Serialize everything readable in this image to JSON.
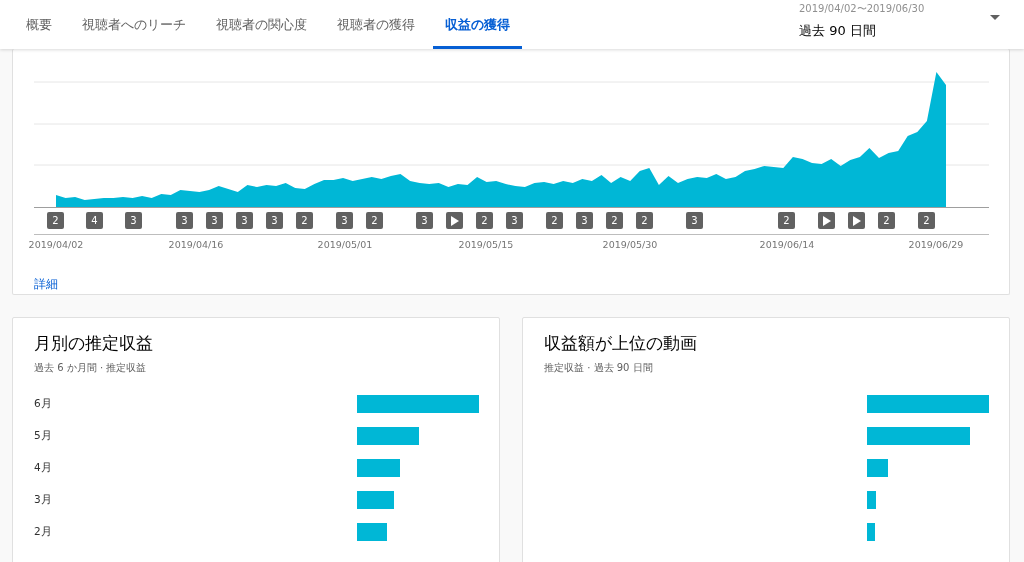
{
  "tabs": [
    {
      "label": "概要",
      "selected": false
    },
    {
      "label": "視聴者へのリーチ",
      "selected": false
    },
    {
      "label": "視聴者の関心度",
      "selected": false
    },
    {
      "label": "視聴者の獲得",
      "selected": false
    },
    {
      "label": "収益の獲得",
      "selected": true
    }
  ],
  "date_range": {
    "range": "2019/04/02〜2019/06/30",
    "period": "過去 90 日間"
  },
  "revenue_chart": {
    "markers": [
      {
        "kind": "count",
        "label": "2"
      },
      {
        "kind": "count",
        "label": "4"
      },
      {
        "kind": "count",
        "label": "3"
      },
      {
        "kind": "count",
        "label": "3"
      },
      {
        "kind": "count",
        "label": "3"
      },
      {
        "kind": "count",
        "label": "3"
      },
      {
        "kind": "count",
        "label": "3"
      },
      {
        "kind": "count",
        "label": "2"
      },
      {
        "kind": "count",
        "label": "3"
      },
      {
        "kind": "count",
        "label": "2"
      },
      {
        "kind": "count",
        "label": "3"
      },
      {
        "kind": "play"
      },
      {
        "kind": "count",
        "label": "2"
      },
      {
        "kind": "count",
        "label": "3"
      },
      {
        "kind": "count",
        "label": "2"
      },
      {
        "kind": "count",
        "label": "3"
      },
      {
        "kind": "count",
        "label": "2"
      },
      {
        "kind": "count",
        "label": "2"
      },
      {
        "kind": "count",
        "label": "3"
      },
      {
        "kind": "count",
        "label": "2"
      },
      {
        "kind": "play"
      },
      {
        "kind": "play"
      },
      {
        "kind": "count",
        "label": "2"
      },
      {
        "kind": "count",
        "label": "2"
      }
    ],
    "x_labels": [
      "2019/04/02",
      "2019/04/16",
      "2019/05/01",
      "2019/05/15",
      "2019/05/30",
      "2019/06/14",
      "2019/06/29"
    ],
    "link": "詳細"
  },
  "monthly_card": {
    "title": "月別の推定収益",
    "subtitle": "過去 6 か月間 · 推定収益",
    "rows": [
      {
        "label": "6月"
      },
      {
        "label": "5月"
      },
      {
        "label": "4月"
      },
      {
        "label": "3月"
      },
      {
        "label": "2月"
      }
    ]
  },
  "top_videos_card": {
    "title": "収益額が上位の動画",
    "subtitle": "推定収益 · 過去 90 日間"
  }
}
